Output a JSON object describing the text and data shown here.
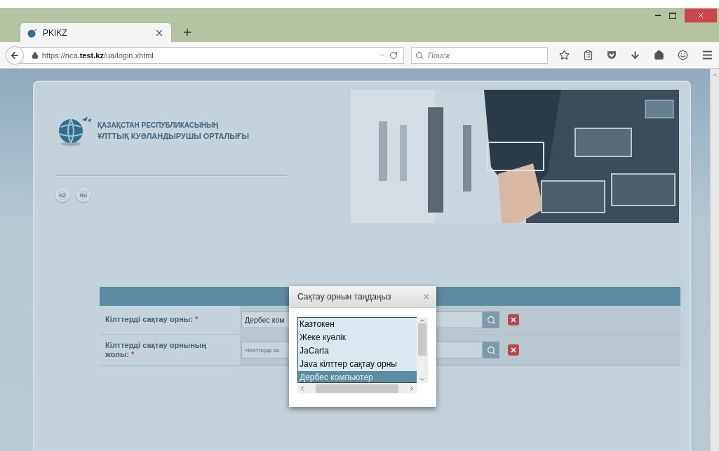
{
  "browser": {
    "tab": {
      "title": "PKIKZ",
      "selected": true
    },
    "address": "https://nca.**test.kz**/ua/login.xhtml",
    "search": {
      "placeholder": "Поиск"
    }
  },
  "header": {
    "line_1": "ҚАЗАҚСТАН РЕСПУБЛИКАСЫНЫҢ",
    "line_2": "ҰЛТТЫҚ КУӘЛАНДЫРУШЫ ОРТАЛЫҒЫ"
  },
  "languages": [
    {
      "label": "KZ"
    },
    {
      "label": "RU"
    }
  ],
  "form": {
    "fields": [
      {
        "label": "Кілттерді сақтау орны:",
        "required_mark": "*",
        "value": "Дербес ком"
      },
      {
        "label": "Кілттерді сақтау орнының жолы:",
        "required_mark": "*",
        "placeholder": "«Кілттерді са"
      }
    ]
  },
  "dialog": {
    "title": "Сақтау орнын таңдаңыз",
    "close": "×",
    "options": [
      {
        "label": "Казтокен",
        "selected": false
      },
      {
        "label": "Жеке куәлік",
        "selected": false
      },
      {
        "label": "JaCarta",
        "selected": false
      },
      {
        "label": "Java кілттер сақтау орны",
        "selected": false
      },
      {
        "label": "Дербес компьютер",
        "selected": true
      }
    ]
  }
}
